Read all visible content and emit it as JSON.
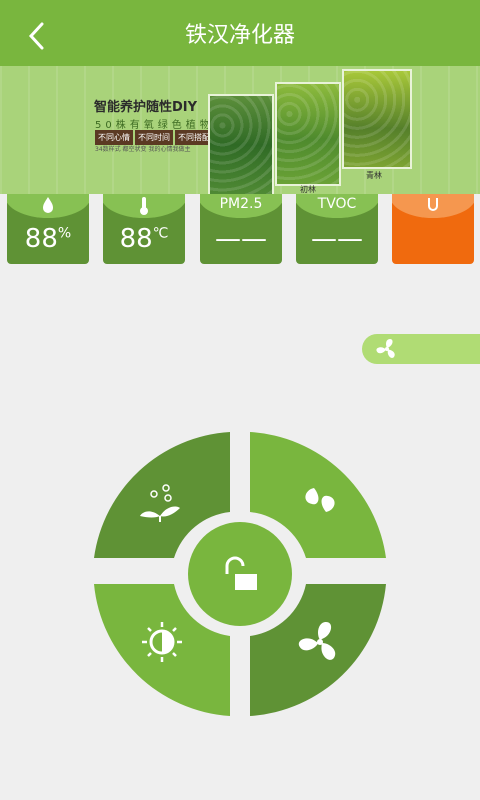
{
  "header": {
    "title": "铁汉净化器"
  },
  "banner": {
    "title": "智能养护随性DIY",
    "subtitle": "50株有氧绿色植物",
    "tags": [
      "不同心情",
      "不同时间",
      "不同搭配"
    ],
    "footer": "34数样式  都空状变  我的心情我做主",
    "labels": [
      "初林",
      "青林"
    ]
  },
  "sensors": [
    {
      "name": "humidity",
      "icon": "water-drop-icon",
      "value": "88",
      "unit": "%"
    },
    {
      "name": "temperature",
      "icon": "thermometer-icon",
      "value": "88",
      "unit": "℃"
    },
    {
      "name": "pm25",
      "label": "PM2.5",
      "value": "——"
    },
    {
      "name": "tvoc",
      "label": "TVOC",
      "value": "——"
    },
    {
      "name": "power",
      "icon": "power-icon",
      "color": "#f06a0e"
    }
  ],
  "controls": {
    "quadrants": [
      "plant-care-icon",
      "ion-mode-icon",
      "brightness-icon",
      "fan-icon"
    ],
    "center": "unlock-icon"
  },
  "colors": {
    "primary": "#79b63e",
    "dark": "#5f9235",
    "light": "#87c153",
    "accent": "#f06a0e"
  }
}
